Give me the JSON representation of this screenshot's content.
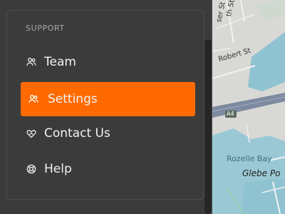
{
  "sidebar": {
    "section_title": "SUPPORT",
    "items": [
      {
        "label": "Team",
        "icon": "users-icon",
        "active": false
      },
      {
        "label": "Settings",
        "icon": "users-icon",
        "active": true
      },
      {
        "label": "Contact Us",
        "icon": "heart-hand-icon",
        "active": false
      },
      {
        "label": "Help",
        "icon": "lifebuoy-icon",
        "active": false
      }
    ],
    "accent_color": "#ff6a00"
  },
  "map": {
    "labels": {
      "street_1": "Robert St",
      "street_2": "th St",
      "street_3": "ser St",
      "road_badge": "A4",
      "bay": "Rozelle Bay",
      "point": "Glebe Po"
    }
  }
}
